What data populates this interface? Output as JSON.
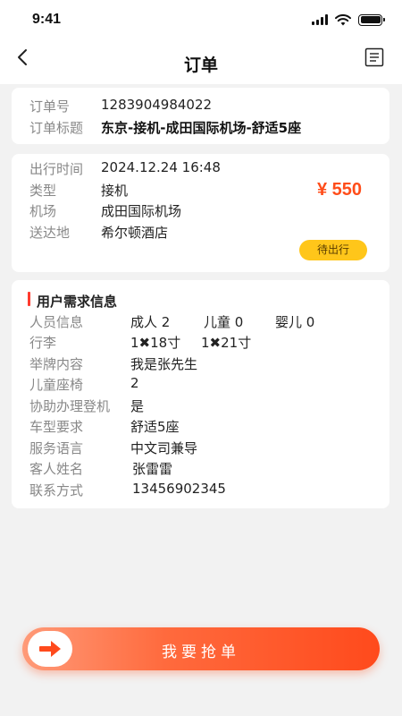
{
  "status_bar": {
    "time": "9:41"
  },
  "nav": {
    "title": "订单"
  },
  "order": {
    "number_label": "订单号",
    "number": "1283904984022",
    "title_label": "订单标题",
    "title": "东京-接机-成田国际机场-舒适5座"
  },
  "trip": {
    "time_label": "出行时间",
    "time": "2024.12.24  16:48",
    "type_label": "类型",
    "type": "接机",
    "airport_label": "机场",
    "airport": "成田国际机场",
    "destination_label": "送达地",
    "destination": "希尔顿酒店",
    "price": "¥ 550",
    "status": "待出行",
    "price_color": "#ff4d1a",
    "status_color": "#ffc61a"
  },
  "requirements": {
    "title": "用户需求信息",
    "passengers_label": "人员信息",
    "adult": "成人 2",
    "child": "儿童 0",
    "infant": "婴儿  0",
    "luggage_label": "行李",
    "luggage_1": "1✖18寸",
    "luggage_2": "1✖21寸",
    "sign_label": "举牌内容",
    "sign": "我是张先生",
    "child_seat_label": "儿童座椅",
    "child_seat": "2",
    "checkin_label": "协助办理登机",
    "checkin": "是",
    "car_label": "车型要求",
    "car": "舒适5座",
    "language_label": "服务语言",
    "language": "中文司兼导",
    "guest_label": "客人姓名",
    "guest": "张雷雷",
    "contact_label": "联系方式",
    "contact": "13456902345"
  },
  "cta": {
    "label": "我要抢单",
    "accent": "#ff4a1c"
  }
}
